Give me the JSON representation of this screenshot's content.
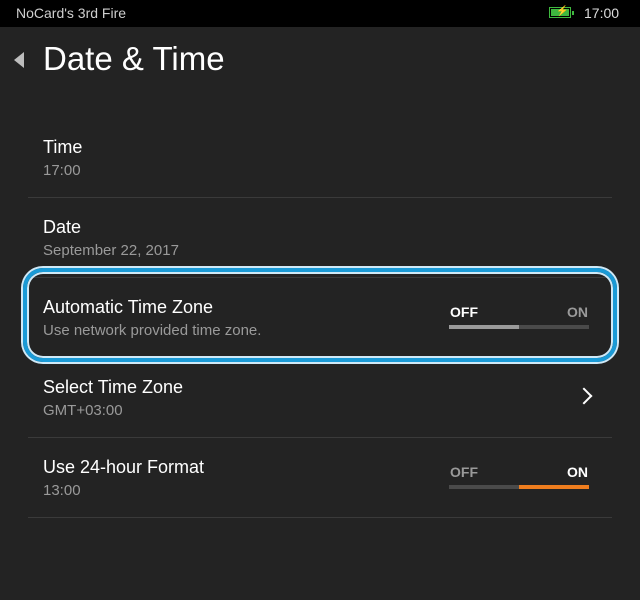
{
  "status_bar": {
    "device_name": "NoCard's 3rd Fire",
    "time": "17:00",
    "battery_icon": "battery-charging-icon",
    "battery_color": "#3fb83f"
  },
  "header": {
    "title": "Date & Time",
    "back_icon": "back-arrow-icon"
  },
  "settings": {
    "time": {
      "title": "Time",
      "value": "17:00"
    },
    "date": {
      "title": "Date",
      "value": "September 22, 2017"
    },
    "auto_timezone": {
      "title": "Automatic Time Zone",
      "subtitle": "Use network provided time zone.",
      "off_label": "OFF",
      "on_label": "ON",
      "state": "off"
    },
    "select_timezone": {
      "title": "Select Time Zone",
      "value": "GMT+03:00"
    },
    "hour_format": {
      "title": "Use 24-hour Format",
      "value": "13:00",
      "off_label": "OFF",
      "on_label": "ON",
      "state": "on"
    }
  },
  "colors": {
    "background": "#232323",
    "accent_on": "#ef7d1e",
    "highlight": "#1a9ad6"
  }
}
